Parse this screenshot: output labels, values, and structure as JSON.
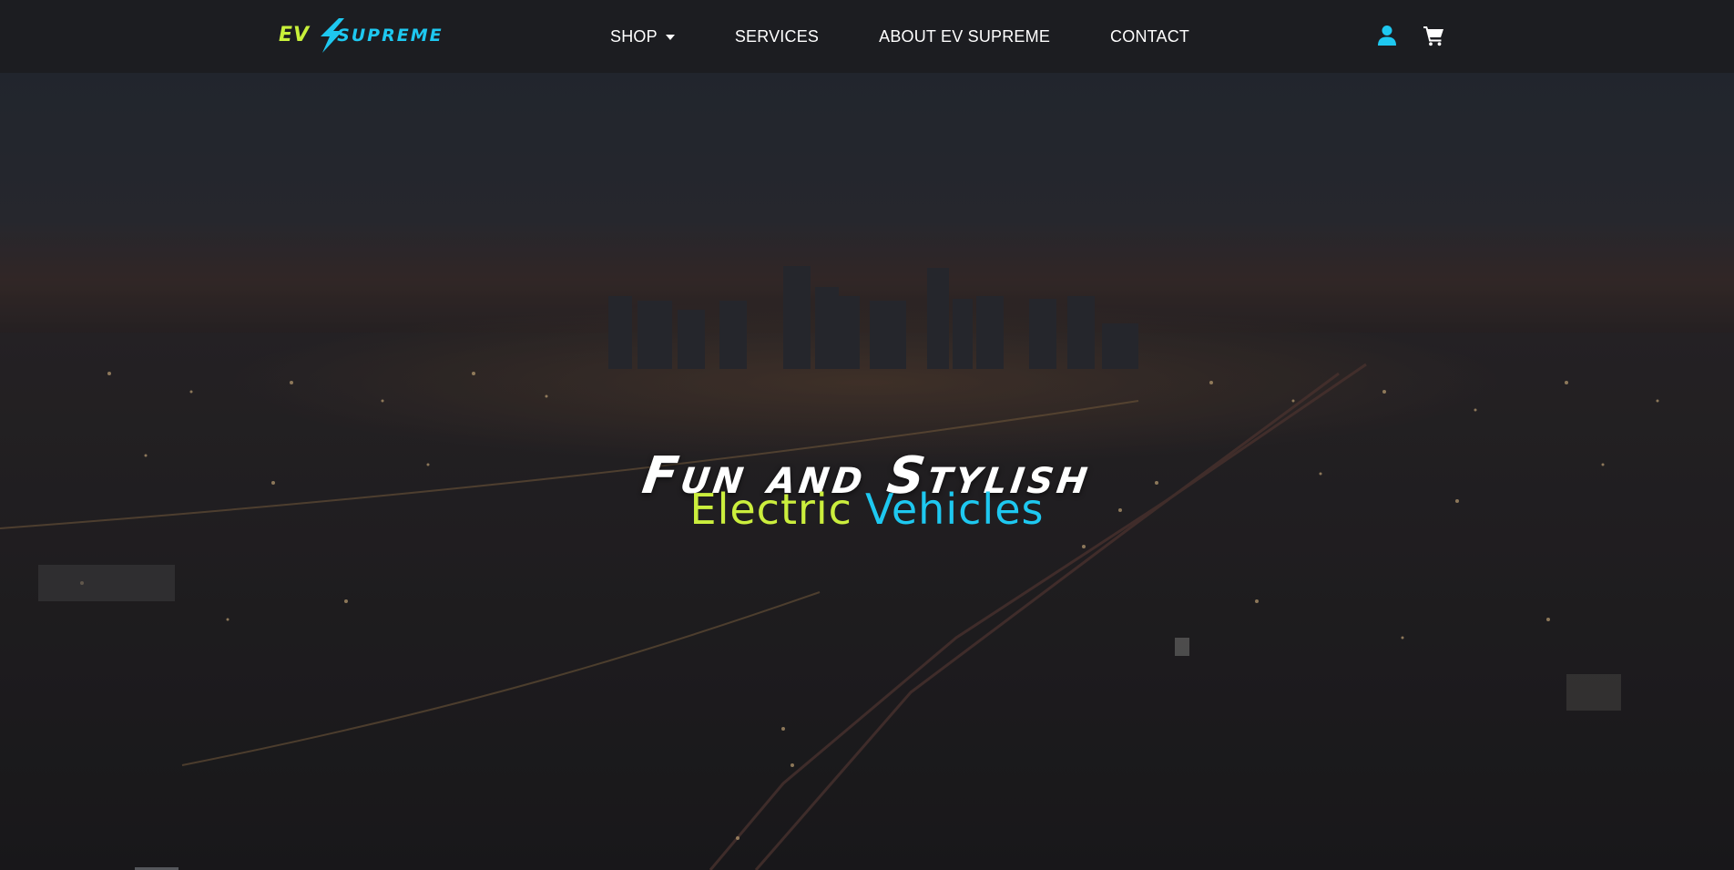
{
  "header": {
    "logo": {
      "text_ev": "EV",
      "text_supreme": "SUPREME"
    },
    "nav": [
      {
        "label": "SHOP",
        "has_dropdown": true
      },
      {
        "label": "SERVICES"
      },
      {
        "label": "ABOUT EV SUPREME"
      },
      {
        "label": "CONTACT"
      }
    ],
    "icons": {
      "account": "user-icon",
      "cart": "cart-icon"
    }
  },
  "hero": {
    "title": "Fun and Stylish",
    "subtitle_part1": "Electric",
    "subtitle_part2": "Vehicles",
    "background": "night-city-skyline-aerial"
  },
  "colors": {
    "navbar_bg": "#1c1d21",
    "accent_lime": "#cbee3d",
    "accent_cyan": "#1ec8f0",
    "text_white": "#ffffff"
  }
}
